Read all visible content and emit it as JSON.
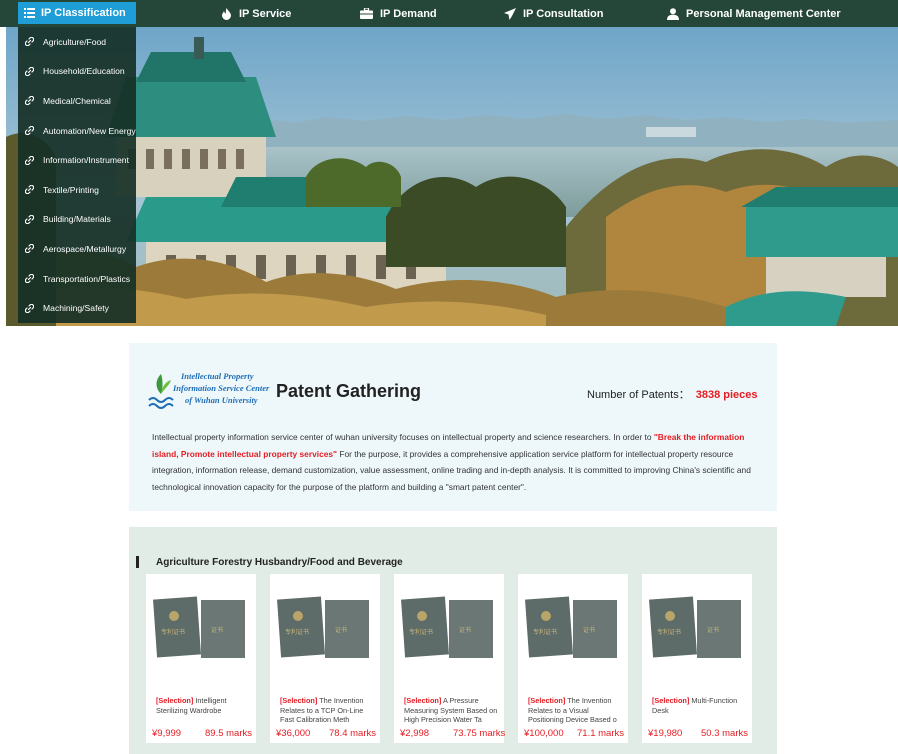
{
  "nav": {
    "classification": "IP Classification",
    "items": [
      {
        "label": "IP Service",
        "icon": "fire-icon"
      },
      {
        "label": "IP Demand",
        "icon": "briefcase-icon"
      },
      {
        "label": "IP Consultation",
        "icon": "paper-plane-icon"
      },
      {
        "label": "Personal Management Center",
        "icon": "user-icon"
      }
    ]
  },
  "sidebar": {
    "items": [
      {
        "label": "Agriculture/Food"
      },
      {
        "label": "Household/Education"
      },
      {
        "label": "Medical/Chemical"
      },
      {
        "label": "Automation/New Energy"
      },
      {
        "label": "Information/Instrument"
      },
      {
        "label": "Textile/Printing"
      },
      {
        "label": "Building/Materials"
      },
      {
        "label": "Aerospace/Metallurgy"
      },
      {
        "label": "Transportation/Plastics"
      },
      {
        "label": "Machining/Safety"
      }
    ]
  },
  "intro": {
    "logo_lines": [
      "Intellectual Property",
      "Information Service Center",
      "of Wuhan University"
    ],
    "title": "Patent Gathering",
    "count_label": "Number of Patents：",
    "count_value": "3838 pieces",
    "desc_part1": "Intellectual property information service center of wuhan university focuses on intellectual property and science researchers. In order to ",
    "desc_highlight": "\"Break the information island, Promote intellectual property services\"",
    "desc_part2": " For the purpose, it provides a comprehensive application service platform for intellectual property resource integration, information release, demand customization, value assessment, online trading and in-depth analysis. It is committed to improving China's scientific and technological innovation capacity for the purpose of the platform and building a \"smart patent center\"."
  },
  "category": {
    "title": "Agriculture Forestry Husbandry/Food and Beverage",
    "products": [
      {
        "tag": "[Selection]",
        "name": "Intelligent Sterilizing Wardrobe",
        "price": "¥9,999",
        "marks": "89.5 marks"
      },
      {
        "tag": "[Selection]",
        "name": "The Invention Relates to a TCP On-Line Fast Calibration Meth",
        "price": "¥36,000",
        "marks": "78.4 marks"
      },
      {
        "tag": "[Selection]",
        "name": "A Pressure Measuring System Based on High Precision Water Ta",
        "price": "¥2,998",
        "marks": "73.75 marks"
      },
      {
        "tag": "[Selection]",
        "name": "The Invention Relates to a Visual Positioning Device Based o",
        "price": "¥100,000",
        "marks": "71.1 marks"
      },
      {
        "tag": "[Selection]",
        "name": "Multi-Function Desk",
        "price": "¥19,980",
        "marks": "50.3 marks"
      }
    ]
  },
  "colors": {
    "nav_bg": "#24473a",
    "nav_active": "#1f9dd6",
    "accent_red": "#e51c23",
    "intro_bg": "#eef8fb",
    "category_bg": "#e1ece6"
  }
}
